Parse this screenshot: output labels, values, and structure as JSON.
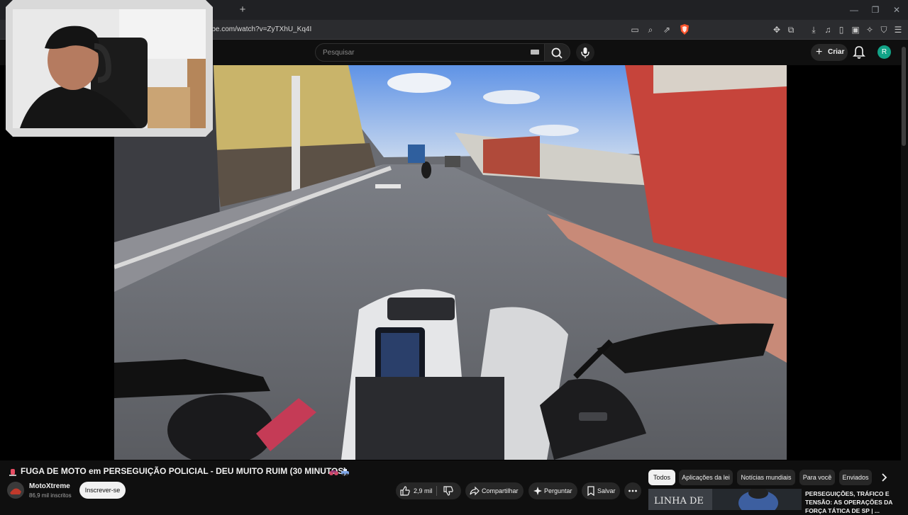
{
  "browser": {
    "new_tab_glyph": "+",
    "url": "tube.com/watch?v=ZyTXhU_Kq4I",
    "window_controls": [
      "minimize-icon",
      "restore-icon",
      "close-icon"
    ],
    "address_icons": [
      "cast-icon",
      "zoom-icon",
      "share-icon",
      "brave-shields-icon"
    ],
    "toolbar_icons": [
      "extensions-icon",
      "screenshot-icon",
      "download-icon",
      "music-icon",
      "sidebar-icon",
      "wallet-icon",
      "leo-ai-icon",
      "vpn-icon",
      "menu-icon"
    ],
    "brave_color": "#fb542b"
  },
  "youtube": {
    "search_placeholder": "Pesquisar",
    "create_label": "Criar",
    "avatar_letter": "R",
    "avatar_color": "#12a387"
  },
  "video": {
    "title": "FUGA DE MOTO em PERSEGUIÇÃO POLICIAL - DEU MUITO RUIM (30 MINUTOS)",
    "channel_name": "MotoXtreme",
    "subscribers": "86,9 mil inscritos",
    "subscribe_label": "Inscrever-se",
    "likes": "2,9 mil",
    "share_label": "Compartilhar",
    "ask_label": "Perguntar",
    "save_label": "Salvar"
  },
  "chips": [
    "Todos",
    "Aplicações da lei",
    "Notícias mundiais",
    "Para você",
    "Enviados"
  ],
  "related": {
    "thumb_text": "LINHA DE",
    "title": "PERSEGUIÇÕES, TRÁFICO E TENSÃO: AS OPERAÇÕES DA FORÇA TÁTICA DE SP | ..."
  }
}
